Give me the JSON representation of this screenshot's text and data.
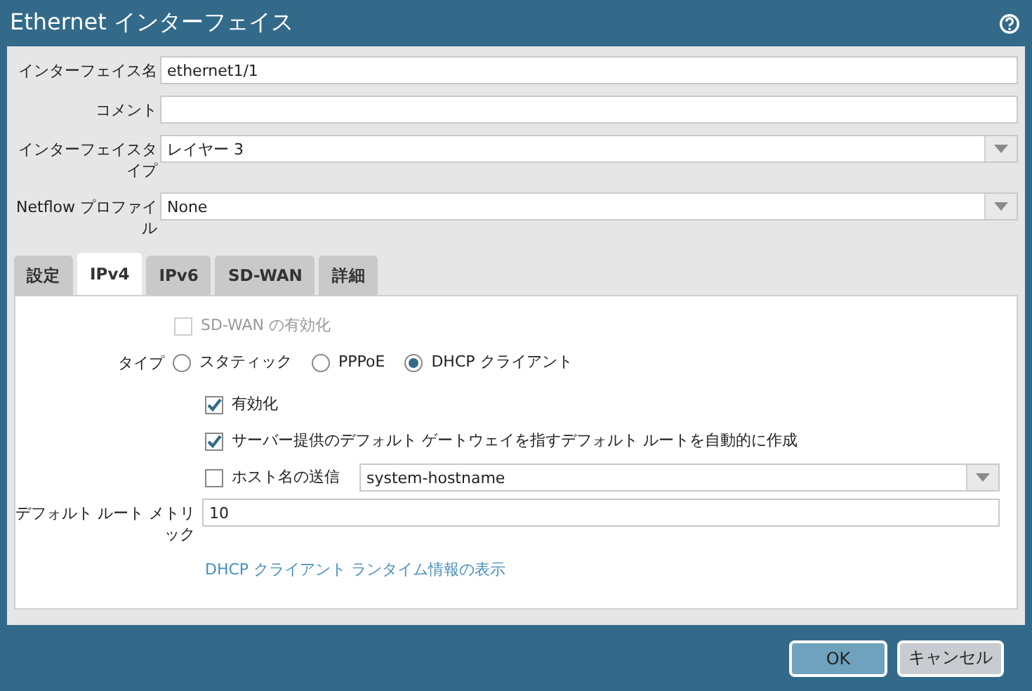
{
  "window": {
    "title": "Ethernet インターフェイス"
  },
  "fields": [
    {
      "label": "インターフェイス名",
      "kind": "text",
      "value": "ethernet1/1"
    },
    {
      "label": "コメント",
      "kind": "text"
    },
    {
      "label": "インターフェイスタイプ",
      "kind": "select",
      "value": "レイヤー 3"
    },
    {
      "label": "Netflow プロファイル",
      "kind": "select",
      "value": "None"
    }
  ],
  "tabs": [
    {
      "label": "設定",
      "selected": false
    },
    {
      "label": "IPv4",
      "selected": true
    },
    {
      "label": "IPv6",
      "selected": false
    },
    {
      "label": "SD-WAN",
      "selected": false
    },
    {
      "label": "詳細",
      "selected": false
    }
  ],
  "ipv4": {
    "sdwan": {
      "label": "SD-WAN の有効化",
      "checked": false,
      "disabled": true
    },
    "type": {
      "label": "タイプ",
      "options": [
        {
          "label": "スタティック",
          "selected": false
        },
        {
          "label": "PPPoE",
          "selected": false
        },
        {
          "label": "DHCP クライアント",
          "selected": true
        }
      ]
    },
    "options": [
      {
        "kind": "checkbox",
        "label": "有効化",
        "checked": true
      },
      {
        "kind": "checkbox",
        "label": "サーバー提供のデフォルト ゲートウェイを指すデフォルト ルートを自動的に作成",
        "checked": true
      },
      {
        "kind": "checkbox-select",
        "label": "ホスト名の送信",
        "checked": false,
        "value": "system-hostname"
      }
    ],
    "metric": {
      "label": "デフォルト ルート メトリック",
      "value": "10"
    },
    "link": "DHCP クライアント ランタイム情報の表示"
  },
  "buttons": [
    {
      "label": "OK",
      "kind": "primary"
    },
    {
      "label": "キャンセル",
      "kind": "secondary"
    }
  ]
}
